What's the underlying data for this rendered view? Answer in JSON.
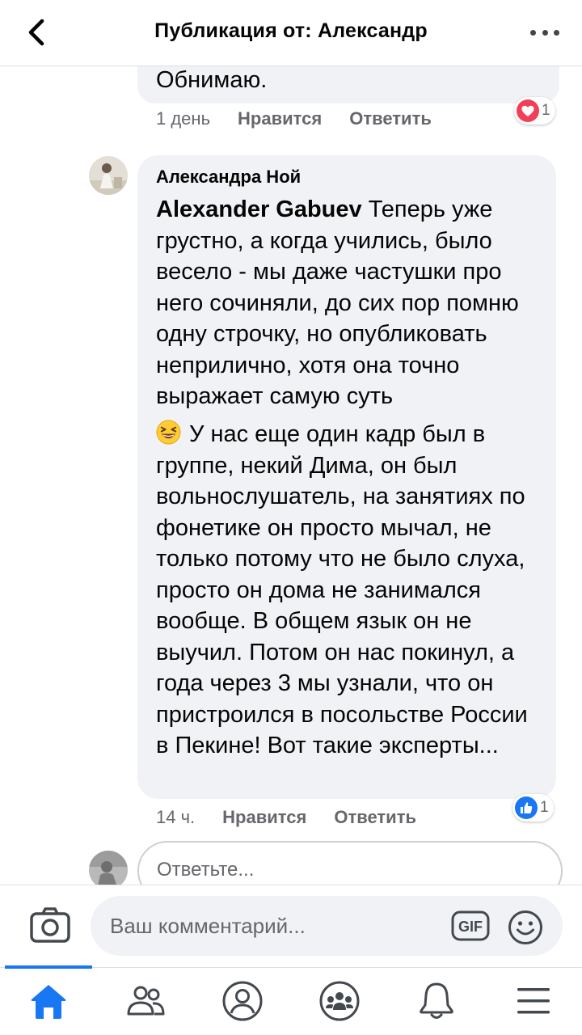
{
  "header": {
    "title": "Публикация от: Александр"
  },
  "previous_comment": {
    "text_tail": "Обнимаю.",
    "time": "1 день",
    "like_label": "Нравится",
    "reply_label": "Ответить",
    "reaction_icon": "love-icon",
    "reaction_count": "1"
  },
  "comment": {
    "author": "Александра Ной",
    "mention": "Alexander Gabuev",
    "paragraph1_rest": " Теперь уже грустно, а когда учились, было весело - мы даже частушки про него сочиняли, до сих пор помню одну строчку, но опубликовать неприлично, хотя она точно выражает самую суть",
    "paragraph2_emoji": "laughing-emoji",
    "paragraph2": "У нас еще один кадр был в группе, некий Дима, он был вольнослушатель, на занятиях по фонетике он просто мычал, не только потому что не было слуха, просто он дома не занимался вообще. В общем язык он не выучил. Потом он нас покинул, а года через 3 мы узнали, что он пристроился в посольстве России в Пекине! Вот такие эксперты...",
    "time": "14 ч.",
    "like_label": "Нравится",
    "reply_label": "Ответить",
    "reaction_icon": "like-icon",
    "reaction_count": "1"
  },
  "reply": {
    "placeholder": "Ответьте..."
  },
  "composer": {
    "placeholder": "Ваш комментарий...",
    "gif_label": "GIF"
  },
  "tabs": [
    {
      "icon": "home-icon",
      "active": true
    },
    {
      "icon": "friends-icon",
      "active": false
    },
    {
      "icon": "profile-icon",
      "active": false
    },
    {
      "icon": "groups-icon",
      "active": false
    },
    {
      "icon": "bell-icon",
      "active": false
    },
    {
      "icon": "menu-icon",
      "active": false
    }
  ],
  "colors": {
    "accent": "#1877f2",
    "bubble": "#f0f2f5",
    "secondary_text": "#65676b",
    "love": "#f33e58"
  }
}
